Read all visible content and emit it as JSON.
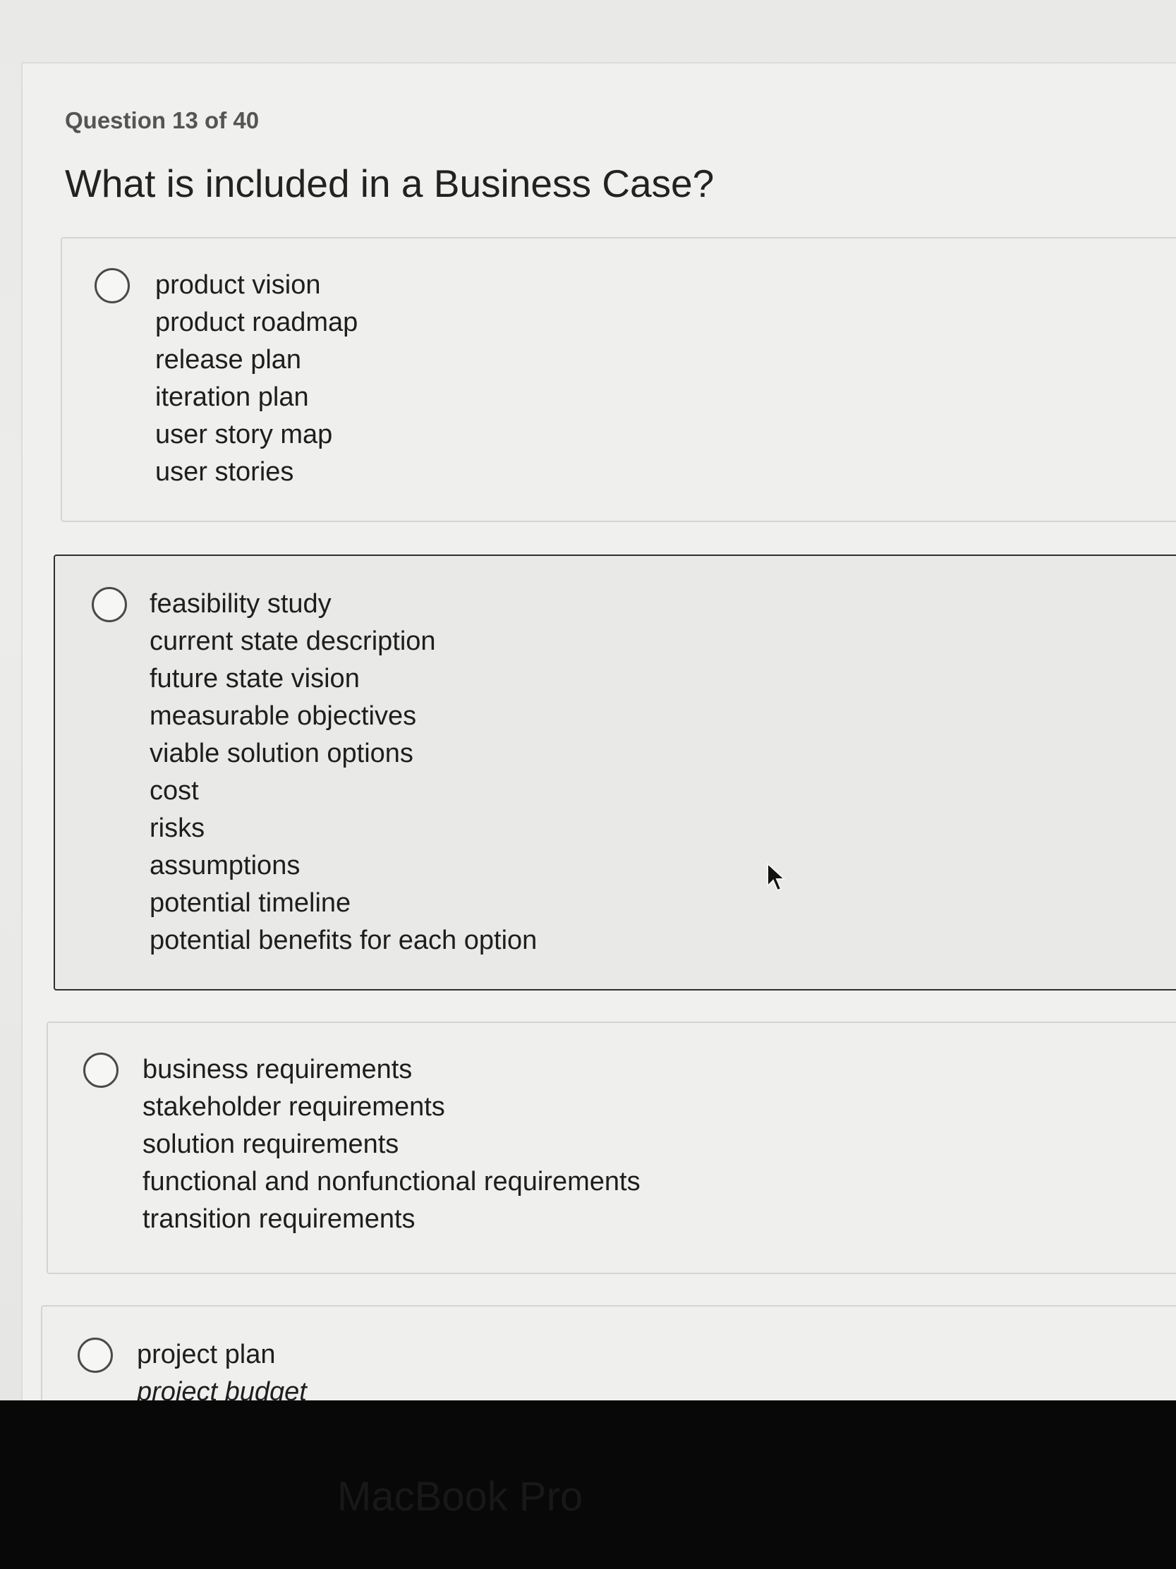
{
  "question": {
    "counter": "Question 13 of 40",
    "text": "What is included in a Business Case?"
  },
  "options": [
    {
      "lines": [
        "product vision",
        "product roadmap",
        "release plan",
        "iteration plan",
        "user story map",
        "user stories"
      ]
    },
    {
      "lines": [
        "feasibility study",
        "current state description",
        "future state vision",
        "measurable objectives",
        "viable solution options",
        "cost",
        "risks",
        "assumptions",
        "potential timeline",
        "potential benefits for each option"
      ]
    },
    {
      "lines": [
        "business requirements",
        "stakeholder requirements",
        "solution requirements",
        "functional and nonfunctional requirements",
        "transition requirements"
      ]
    },
    {
      "lines": [
        "project plan",
        "project budget"
      ]
    }
  ],
  "device": {
    "brand": "MacBook Pro"
  },
  "icons": {
    "radio": "radio-button-icon",
    "cursor": "mouse-pointer-icon"
  }
}
